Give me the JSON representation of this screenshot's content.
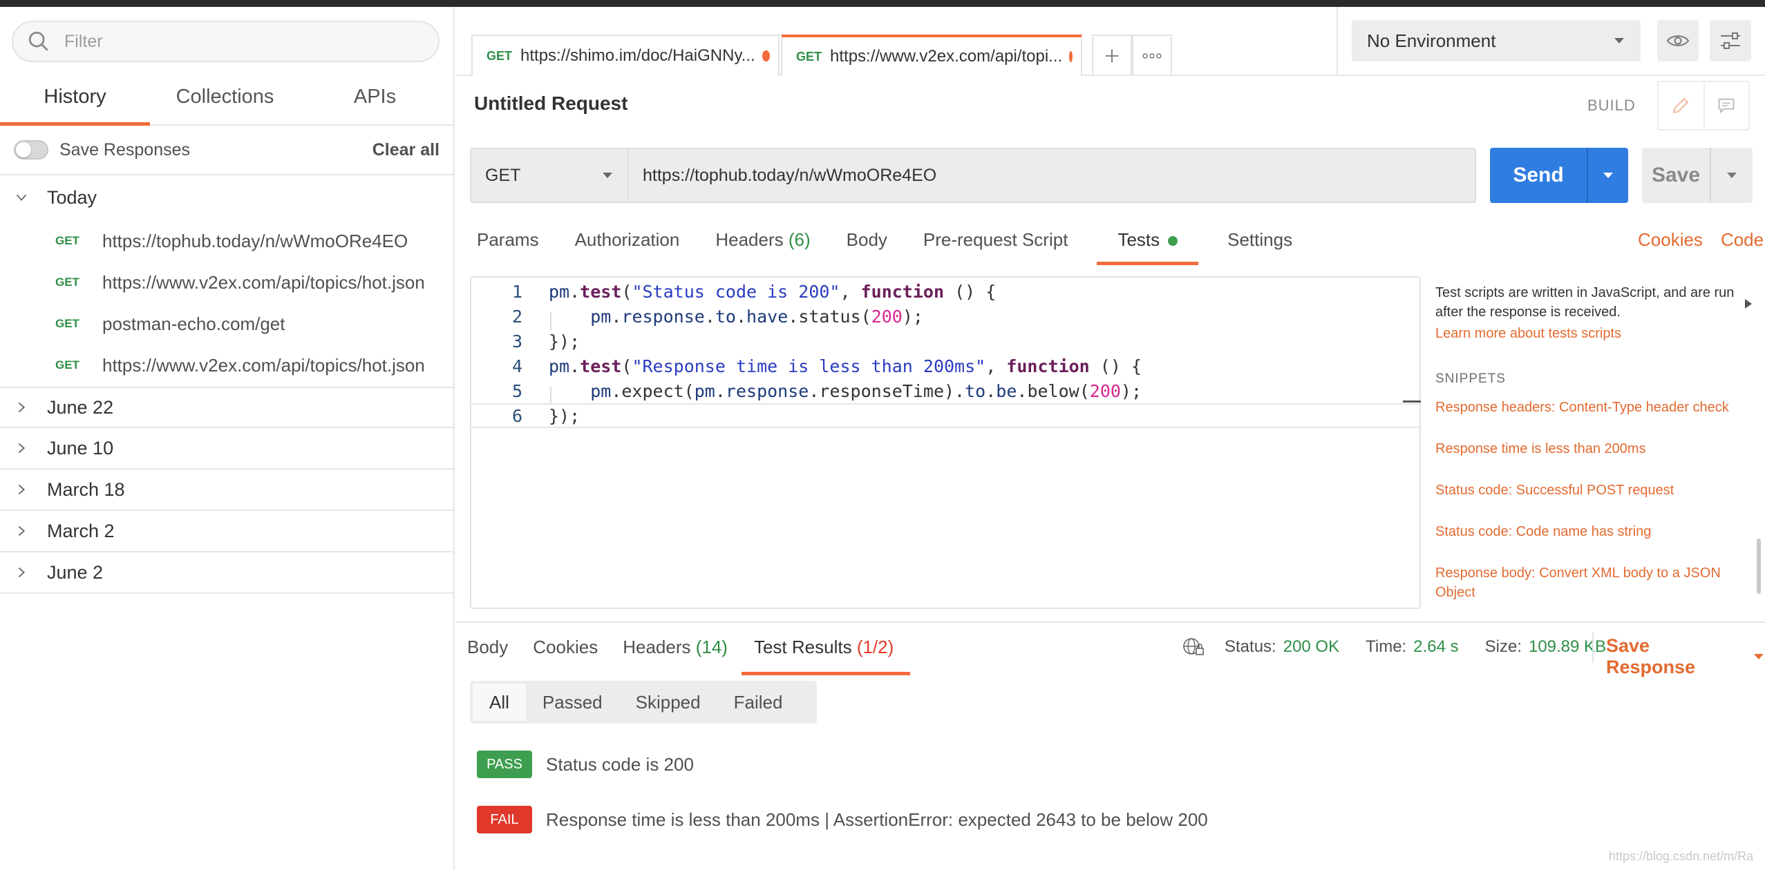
{
  "sidebar": {
    "filter_placeholder": "Filter",
    "tabs": [
      "History",
      "Collections",
      "APIs"
    ],
    "save_responses_label": "Save Responses",
    "clear_all_label": "Clear all",
    "groups": [
      "Today",
      "June 22",
      "June 10",
      "March 18",
      "March 2",
      "June 2"
    ],
    "today_items": [
      {
        "method": "GET",
        "url": "https://tophub.today/n/wWmoORe4EO"
      },
      {
        "method": "GET",
        "url": "https://www.v2ex.com/api/topics/hot.json"
      },
      {
        "method": "GET",
        "url": "postman-echo.com/get"
      },
      {
        "method": "GET",
        "url": "https://www.v2ex.com/api/topics/hot.json"
      }
    ]
  },
  "request_tabs": [
    {
      "method": "GET",
      "url": "https://shimo.im/doc/HaiGNNy..."
    },
    {
      "method": "GET",
      "url": "https://www.v2ex.com/api/topi..."
    }
  ],
  "environment": {
    "selected": "No Environment"
  },
  "request": {
    "title": "Untitled Request",
    "build_label": "BUILD",
    "method": "GET",
    "url": "https://tophub.today/n/wWmoORe4EO",
    "send_label": "Send",
    "save_label": "Save"
  },
  "subtabs": {
    "params": "Params",
    "authorization": "Authorization",
    "headers": "Headers",
    "headers_count": "(6)",
    "body": "Body",
    "prerequest": "Pre-request Script",
    "tests": "Tests",
    "settings": "Settings",
    "cookies": "Cookies",
    "code": "Code"
  },
  "editor": {
    "line_numbers": [
      "1",
      "2",
      "3",
      "4",
      "5",
      "6"
    ]
  },
  "tests_panel": {
    "description": "Test scripts are written in JavaScript, and are run after the response is received.",
    "learn_more": "Learn more about tests scripts",
    "snippets_header": "SNIPPETS",
    "snippets": [
      "Response headers: Content-Type header check",
      "Response time is less than 200ms",
      "Status code: Successful POST request",
      "Status code: Code name has string",
      "Response body: Convert XML body to a JSON Object"
    ]
  },
  "response": {
    "tabs": {
      "body": "Body",
      "cookies": "Cookies",
      "headers": "Headers",
      "headers_count": "(14)",
      "test_results": "Test Results",
      "test_results_count": "(1/2)"
    },
    "status_label": "Status:",
    "status_value": "200 OK",
    "time_label": "Time:",
    "time_value": "2.64 s",
    "size_label": "Size:",
    "size_value": "109.89 KB",
    "save_response_label": "Save Response",
    "filters": [
      "All",
      "Passed",
      "Skipped",
      "Failed"
    ],
    "results": [
      {
        "status": "PASS",
        "text": "Status code is 200"
      },
      {
        "status": "FAIL",
        "text": "Response time is less than 200ms | AssertionError: expected 2643 to be below 200"
      }
    ]
  },
  "watermark": "https://blog.csdn.net/m/Ra",
  "colors": {
    "accent": "#f26b3a",
    "send": "#2f7de1",
    "pass": "#3e9e4f",
    "fail": "#e0392b",
    "method_get": "#2f8f47"
  }
}
